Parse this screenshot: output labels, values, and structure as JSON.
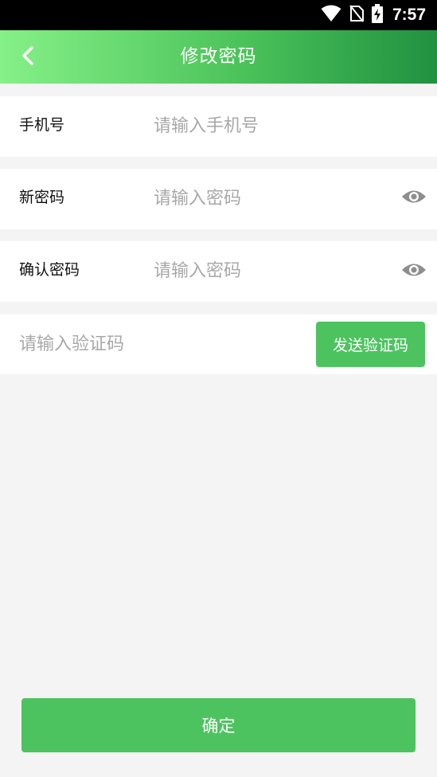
{
  "status_bar": {
    "time": "7:57",
    "icons": [
      "wifi-icon",
      "no-sim-icon",
      "battery-charging-icon"
    ]
  },
  "toolbar": {
    "title": "修改密码",
    "back_icon": "chevron-left-icon"
  },
  "form": {
    "phone": {
      "label": "手机号",
      "placeholder": "请输入手机号",
      "value": ""
    },
    "new_password": {
      "label": "新密码",
      "placeholder": "请输入密码",
      "value": "",
      "toggle_icon": "eye-icon"
    },
    "confirm_password": {
      "label": "确认密码",
      "placeholder": "请输入密码",
      "value": "",
      "toggle_icon": "eye-icon"
    },
    "verification": {
      "placeholder": "请输入验证码",
      "value": "",
      "send_button": "发送验证码"
    }
  },
  "confirm_button": "确定",
  "colors": {
    "accent": "#4cc35f",
    "toolbar_gradient_start": "#86f088",
    "toolbar_gradient_end": "#219141",
    "background": "#f4f4f4"
  }
}
